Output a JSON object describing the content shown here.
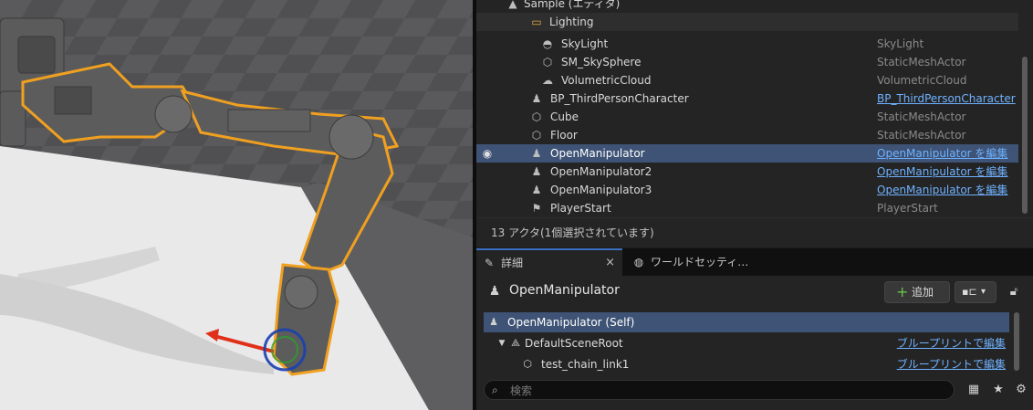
{
  "outliner": {
    "rows": [
      {
        "label": "Sample (エディタ)",
        "type": "",
        "icon": "level-icon"
      },
      {
        "label": "Lighting",
        "type": "",
        "icon": "folder-icon"
      },
      {
        "label": "SkyLight",
        "type": "SkyLight",
        "icon": "skylight-icon"
      },
      {
        "label": "SM_SkySphere",
        "type": "StaticMeshActor",
        "icon": "static-mesh-icon"
      },
      {
        "label": "VolumetricCloud",
        "type": "VolumetricCloud",
        "icon": "cloud-icon"
      },
      {
        "label": "BP_ThirdPersonCharacter",
        "type": "BP_ThirdPersonCharacter",
        "icon": "pawn-icon"
      },
      {
        "label": "Cube",
        "type": "StaticMeshActor",
        "icon": "static-mesh-icon"
      },
      {
        "label": "Floor",
        "type": "StaticMeshActor",
        "icon": "static-mesh-icon"
      },
      {
        "label": "OpenManipulator",
        "type": "OpenManipulator を編集",
        "icon": "pawn-icon"
      },
      {
        "label": "OpenManipulator2",
        "type": "OpenManipulator を編集",
        "icon": "pawn-icon"
      },
      {
        "label": "OpenManipulator3",
        "type": "OpenManipulator を編集",
        "icon": "pawn-icon"
      },
      {
        "label": "PlayerStart",
        "type": "PlayerStart",
        "icon": "player-start-icon"
      }
    ],
    "status": "13 アクタ(1個選択されています)"
  },
  "tabs": {
    "details_label": "詳細",
    "world_label": "ワールドセッティ…"
  },
  "details": {
    "actor_name": "OpenManipulator",
    "add_label": "追加",
    "components": [
      {
        "label": "OpenManipulator (Self)",
        "link": ""
      },
      {
        "label": "DefaultSceneRoot",
        "link": "ブループリントで編集"
      },
      {
        "label": "test_chain_link1",
        "link": "ブループリントで編集"
      }
    ],
    "search_placeholder": "検索"
  },
  "colors": {
    "selection": "#3e5375",
    "link": "#6fb2ff",
    "selection_outline": "#f0a020",
    "add_plus": "#69c34a"
  }
}
